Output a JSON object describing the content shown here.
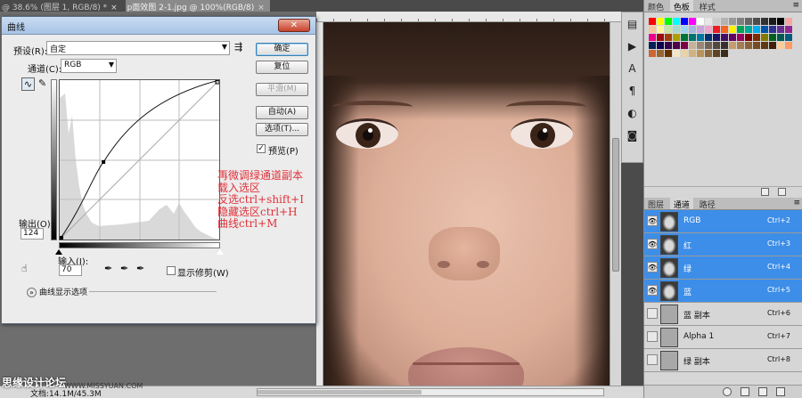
{
  "tabs": [
    {
      "label": "@ 38.6% (图层 1, RGB/8) *",
      "close": "×"
    },
    {
      "label": "p面效图 2-1.jpg @ 100%(RGB/8)",
      "close": "×"
    }
  ],
  "dialog": {
    "title": "曲线",
    "preset_label": "预设(R):",
    "preset_value": "自定",
    "channel_label": "通道(C):",
    "channel_value": "RGB",
    "output_label": "输出(O):",
    "output_value": "124",
    "input_label": "输入(I):",
    "input_value": "70",
    "buttons": {
      "ok": "确定",
      "reset": "复位",
      "smooth": "平滑(M)",
      "auto": "自动(A)",
      "options": "选项(T)..."
    },
    "preview_label": "预览(P)",
    "preview_checked": true,
    "show_clipping_label": "显示修剪(W)",
    "show_clipping_checked": false,
    "curve_options_label": "曲线显示选项",
    "curve_point": {
      "input": 70,
      "output": 124
    }
  },
  "annotation": [
    "再微调绿通道副本",
    "载入选区",
    "反选ctrl+shift+I",
    "隐藏选区ctrl+H",
    "曲线ctrl+M"
  ],
  "right_panel": {
    "top_tabs": [
      "颜色",
      "色板",
      "样式"
    ],
    "active_top_tab": "色板",
    "bottom_tabs": [
      "图层",
      "通道",
      "路径"
    ],
    "active_bottom_tab": "通道",
    "channels": [
      {
        "name": "RGB",
        "shortcut": "Ctrl+2",
        "visible": true,
        "selected": true
      },
      {
        "name": "红",
        "shortcut": "Ctrl+3",
        "visible": true,
        "selected": true
      },
      {
        "name": "绿",
        "shortcut": "Ctrl+4",
        "visible": true,
        "selected": true
      },
      {
        "name": "蓝",
        "shortcut": "Ctrl+5",
        "visible": true,
        "selected": true
      },
      {
        "name": "蓝 副本",
        "shortcut": "Ctrl+6",
        "visible": false,
        "selected": false
      },
      {
        "name": "Alpha 1",
        "shortcut": "Ctrl+7",
        "visible": false,
        "selected": false
      },
      {
        "name": "绿 副本",
        "shortcut": "Ctrl+8",
        "visible": false,
        "selected": false
      }
    ],
    "swatch_colors": [
      "#ff0000",
      "#ffff00",
      "#00ff00",
      "#00ffff",
      "#0000ff",
      "#ff00ff",
      "#ffffff",
      "#e6e6e6",
      "#cccccc",
      "#b3b3b3",
      "#999999",
      "#808080",
      "#666666",
      "#4d4d4d",
      "#333333",
      "#1a1a1a",
      "#000000",
      "#f4a6a0",
      "#f7c59b",
      "#fff5a0",
      "#c7e3a5",
      "#a6d9c7",
      "#9fd4f0",
      "#a8b5e0",
      "#c6a5d8",
      "#f0a5cc",
      "#ed1c24",
      "#f26522",
      "#fff200",
      "#00a651",
      "#00a99d",
      "#00aeef",
      "#0054a6",
      "#2e3192",
      "#662d91",
      "#92278f",
      "#ec008c",
      "#9e0b0f",
      "#a0410d",
      "#aba000",
      "#007236",
      "#00746b",
      "#0076a3",
      "#003471",
      "#1b1464",
      "#440e62",
      "#630460",
      "#9e005d",
      "#790000",
      "#7b2e00",
      "#827b00",
      "#005e20",
      "#005952",
      "#005b7f",
      "#002157",
      "#0d004c",
      "#32004b",
      "#4b0049",
      "#7b0046",
      "#c7b299",
      "#998675",
      "#736357",
      "#534741",
      "#37302c",
      "#c69c6d",
      "#a67c52",
      "#8c6239",
      "#754c24",
      "#603913",
      "#42210b",
      "#ffcc99",
      "#ff9966",
      "#cc6633",
      "#996633",
      "#663300",
      "#f5e6c8",
      "#e8d2a6",
      "#d1b27c",
      "#b8935a",
      "#8a6a3c",
      "#5e4526",
      "#3d2c18"
    ],
    "status": "文档:14.1M/45.3M"
  },
  "watermark": "思缘设计论坛",
  "watermark_url": "WWW.MISSYUAN.COM"
}
